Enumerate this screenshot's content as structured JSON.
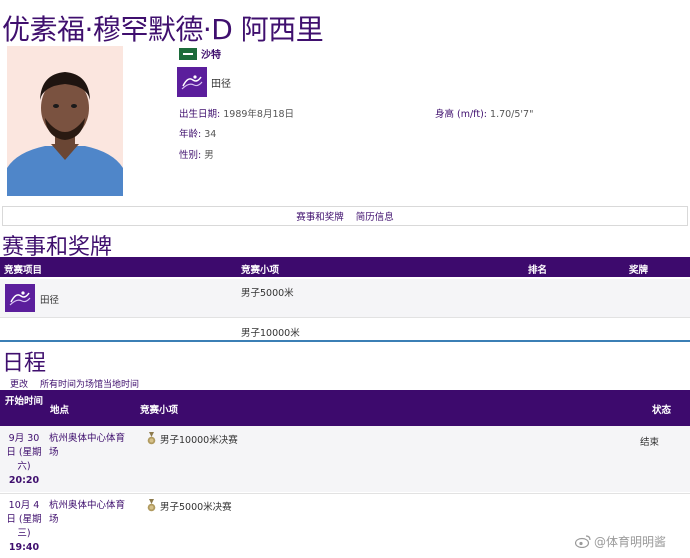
{
  "athlete": {
    "name": "优素福·穆罕默德·D 阿西里",
    "country": "沙特",
    "sport": "田径",
    "birth_label": "出生日期:",
    "birth_value": "1989年8月18日",
    "height_label": "身高 (m/ft):",
    "height_value": "1.70/5'7\"",
    "age_label": "年龄:",
    "age_value": "34",
    "gender_label": "性别:",
    "gender_value": "男"
  },
  "tabs": [
    "赛事和奖牌",
    "简历信息"
  ],
  "medals": {
    "title": "赛事和奖牌",
    "headers": [
      "竞赛项目",
      "竞赛小项",
      "排名",
      "奖牌"
    ],
    "sport": "田径",
    "events": [
      "男子5000米",
      "男子10000米"
    ]
  },
  "schedule": {
    "title": "日程",
    "change_label": "更改",
    "tz_note": "所有时间为场馆当地时间",
    "headers": [
      "开始时间",
      "地点",
      "竞赛小项",
      "状态"
    ],
    "rows": [
      {
        "date": "9月 30日 (星期六)",
        "time": "20:20",
        "venue": "杭州奥体中心体育场",
        "event": "男子10000米决赛",
        "status": "结束"
      },
      {
        "date": "10月 4日 (星期三)",
        "time": "19:40",
        "venue": "杭州奥体中心体育场",
        "event": "男子5000米决赛",
        "status": ""
      }
    ]
  },
  "watermark": "@体育明明酱",
  "colors": {
    "primary": "#3d0a6d",
    "accent": "#5b1e9c",
    "divider": "#3b7fb5"
  }
}
